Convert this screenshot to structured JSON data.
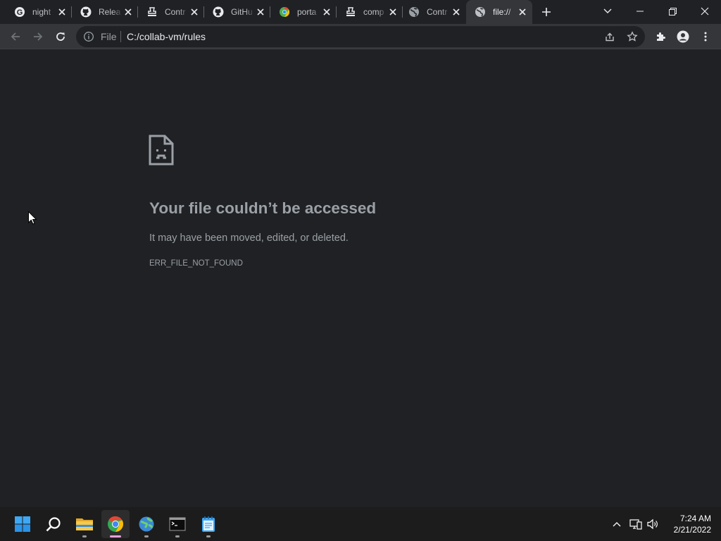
{
  "browser": {
    "tabs": [
      {
        "title": "night",
        "icon": "google-icon"
      },
      {
        "title": "Relea",
        "icon": "github-icon"
      },
      {
        "title": "Contr",
        "icon": "stamp-icon"
      },
      {
        "title": "GitHu",
        "icon": "github-icon"
      },
      {
        "title": "porta",
        "icon": "chrome-web-icon"
      },
      {
        "title": "comp",
        "icon": "stamp-icon"
      },
      {
        "title": "Contr",
        "icon": "globe-icon"
      },
      {
        "title": "file://",
        "icon": "globe-icon",
        "active": true
      }
    ],
    "address": {
      "scheme_chip": "File",
      "url": "C:/collab-vm/rules"
    }
  },
  "error_page": {
    "heading": "Your file couldn’t be accessed",
    "message": "It may have been moved, edited, or deleted.",
    "code": "ERR_FILE_NOT_FOUND"
  },
  "taskbar": {
    "apps": [
      "start-icon",
      "search-icon",
      "file-explorer-icon",
      "chrome-icon",
      "globe-app-icon",
      "terminal-icon",
      "notepad-icon"
    ],
    "clock": {
      "time": "7:24 AM",
      "date": "2/21/2022"
    }
  },
  "colors": {
    "chrome_dark": "#202124",
    "toolbar": "#35363a",
    "text_muted": "#9aa0a6",
    "taskbar": "#1c1c1c"
  }
}
